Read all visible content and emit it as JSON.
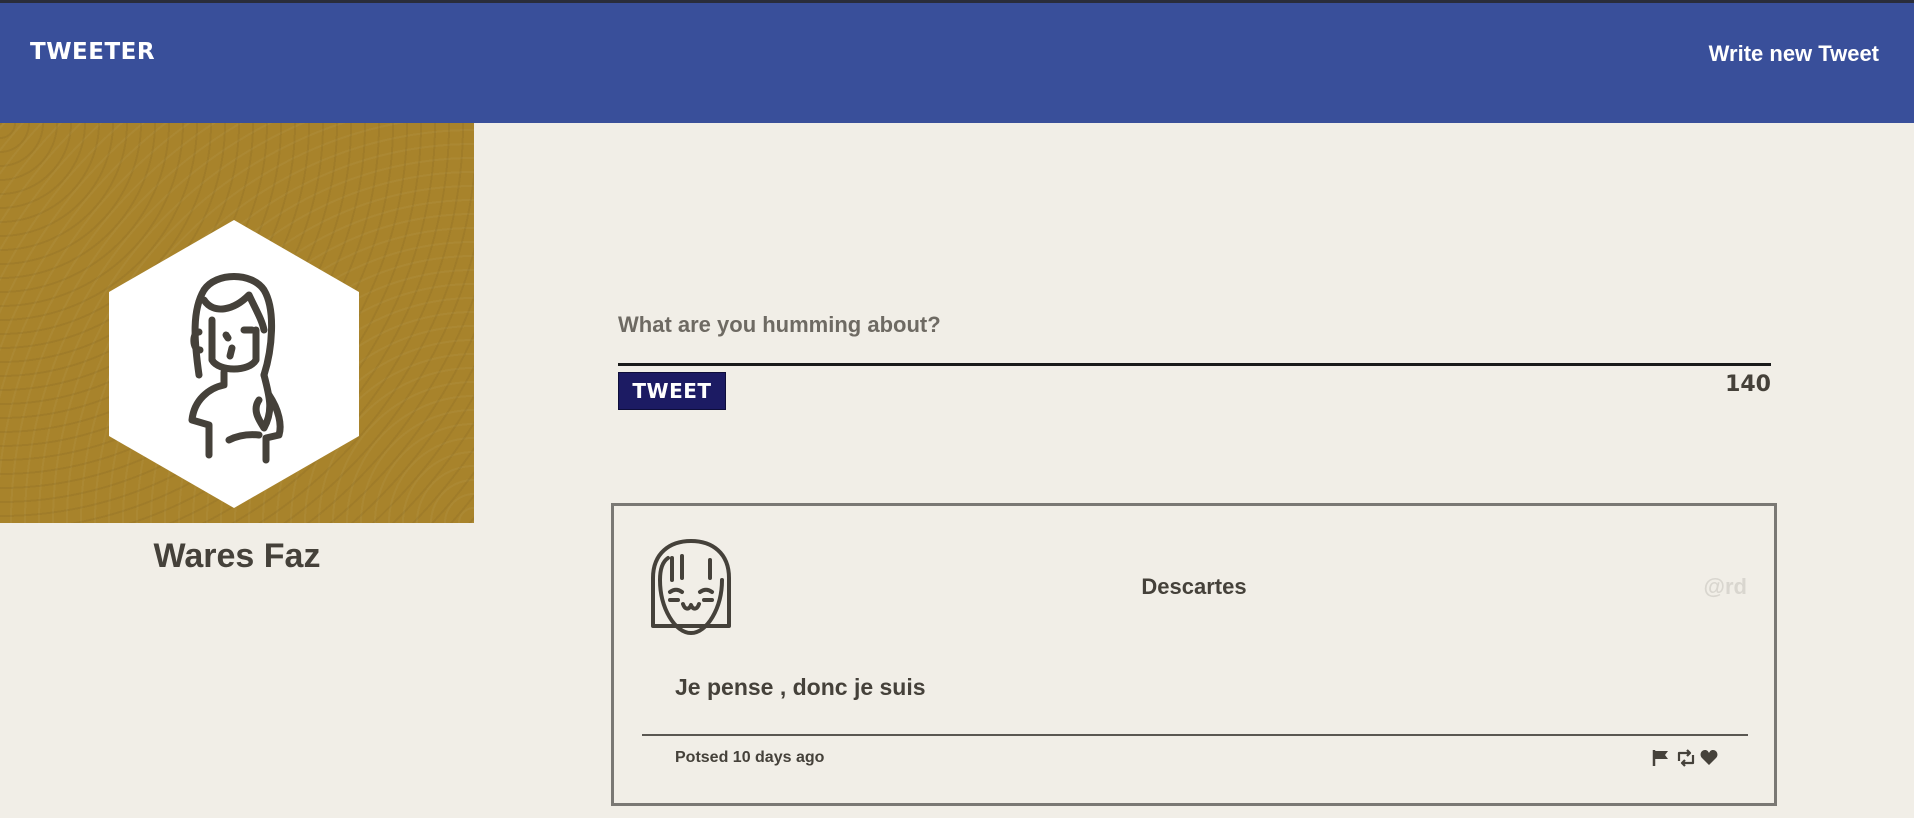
{
  "nav": {
    "brand": "TWEETER",
    "compose_link": "Write new Tweet"
  },
  "profile": {
    "name": "Wares Faz",
    "banner_color": "#a8832b",
    "avatar_icon": "girl-avatar-icon"
  },
  "compose": {
    "placeholder": "What are you humming about?",
    "value": "",
    "button_label": "TWEET",
    "char_count": "140"
  },
  "tweets": [
    {
      "author": "Descartes",
      "handle": "@rd",
      "text": "Je pense , donc je suis",
      "posted": "Potsed 10 days ago",
      "avatar_icon": "smiling-girl-avatar-icon",
      "actions": [
        "flag-icon",
        "retweet-icon",
        "heart-icon"
      ]
    }
  ],
  "colors": {
    "navbar": "#394f9a",
    "background": "#f1eee7",
    "tweet_button": "#1c1b63",
    "text": "#45413a"
  }
}
